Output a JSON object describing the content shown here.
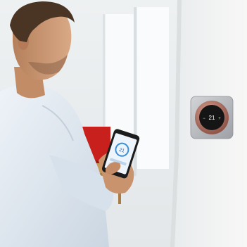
{
  "thermostat": {
    "temperature": "21",
    "decrease_symbol": "−",
    "increase_symbol": "+"
  },
  "phone": {
    "app_readout": "21"
  },
  "colors": {
    "wall": "#f4f4f3",
    "red_panel": "#c8201c",
    "thermostat_plate": "#b7b9bc",
    "thermostat_ring": "#b06a5a",
    "thermostat_face": "#151515",
    "shirt": "#dde6ef",
    "skin": "#c8956f",
    "hair": "#4a3524",
    "table_wood": "#c89a5a"
  },
  "icons": {
    "thermostat": "round-thermostat-icon",
    "phone": "smartphone-icon",
    "tablet": "tablet-icon",
    "laptop": "laptop-icon"
  }
}
